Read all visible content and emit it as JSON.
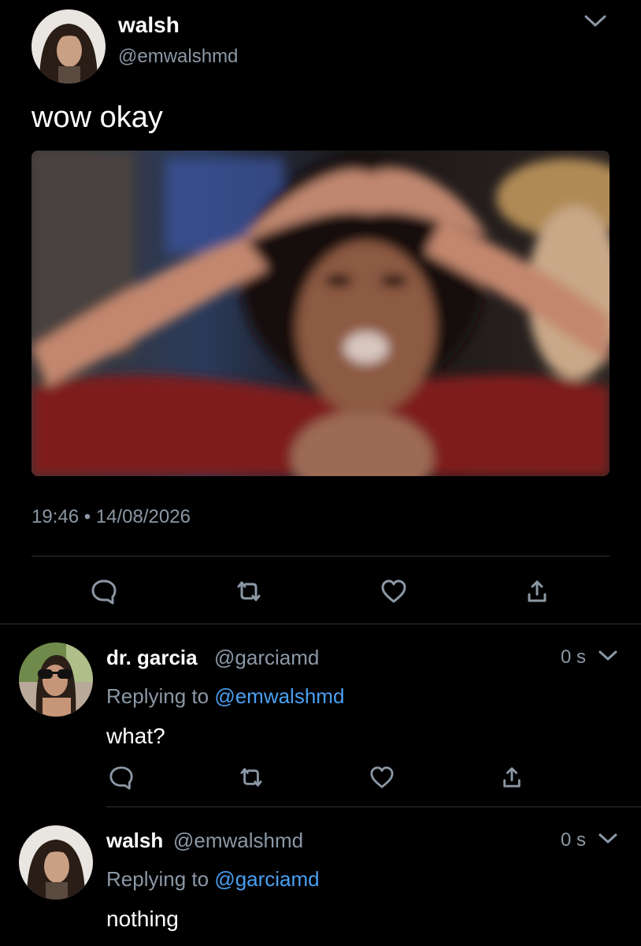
{
  "main_tweet": {
    "display_name": "walsh",
    "handle": "@emwalshmd",
    "text": "wow okay",
    "media_description": "blurry meme photo of a woman holding her hands on top of her head",
    "timestamp": "19:46 • 14/08/2026",
    "actions": [
      "reply-icon",
      "retweet-icon",
      "like-icon",
      "share-icon"
    ]
  },
  "replies": [
    {
      "display_name": "dr. garcia",
      "handle": "@garciamd",
      "time": "0 s",
      "replying_prefix": "Replying to",
      "replying_handle": "@emwalshmd",
      "text": "what?"
    },
    {
      "display_name": "walsh",
      "handle": "@emwalshmd",
      "time": "0 s",
      "replying_prefix": "Replying to",
      "replying_handle": "@garciamd",
      "text": "nothing"
    }
  ],
  "colors": {
    "background": "#000000",
    "text": "#ffffff",
    "muted": "#8b98a5",
    "link": "#4a9ff0",
    "divider": "#2f3336"
  }
}
